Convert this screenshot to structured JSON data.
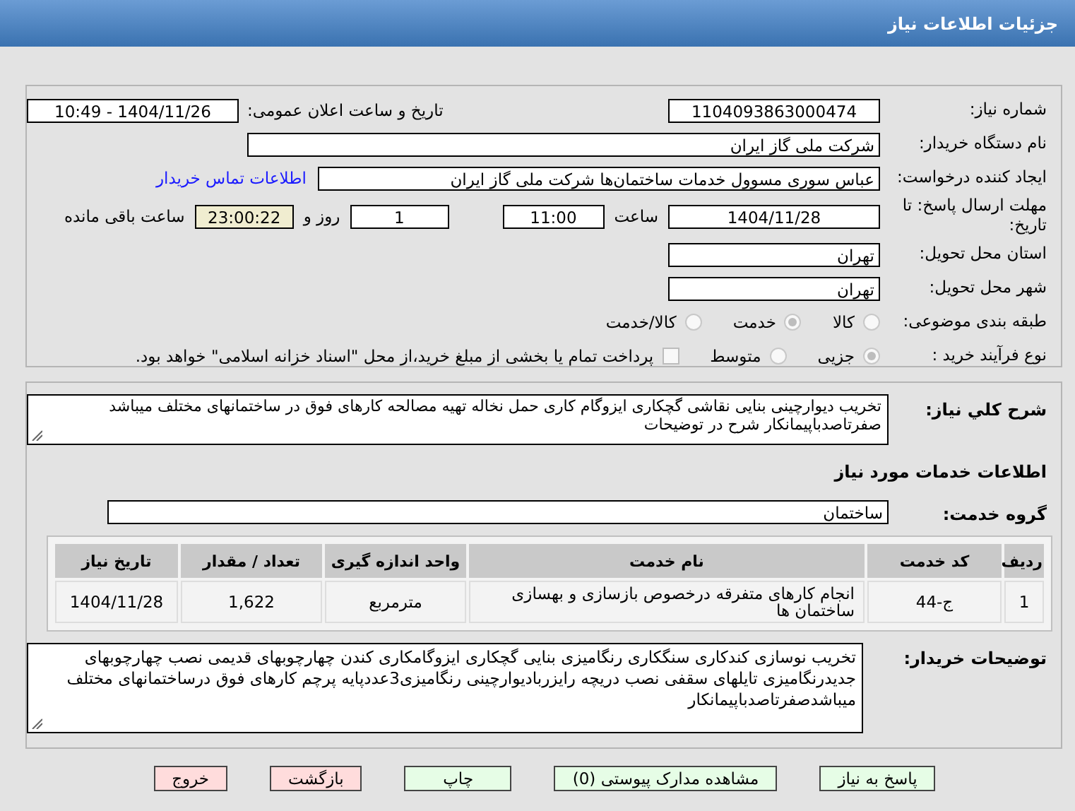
{
  "header": {
    "title": "جزئیات اطلاعات نیاز"
  },
  "details": {
    "need_number": {
      "label": "شماره نیاز:",
      "value": "1104093863000474"
    },
    "announce": {
      "label": "تاریخ و ساعت اعلان عمومی:",
      "value": "1404/11/26 - 10:49"
    },
    "buyer": {
      "label": "نام دستگاه خریدار:",
      "value": "شرکت ملی گاز ایران"
    },
    "creator": {
      "label": "ایجاد کننده درخواست:",
      "value": "عباس سوری مسوول خدمات ساختمان‌ها  شرکت ملی گاز ایران",
      "contact_link": "اطلاعات تماس خریدار"
    },
    "deadline": {
      "label": "مهلت ارسال پاسخ: تا تاریخ:",
      "date": "1404/11/28",
      "time_label": "ساعت",
      "time": "11:00",
      "days": "1",
      "days_label": "روز و",
      "remaining": "23:00:22",
      "remaining_label": "ساعت باقی مانده"
    },
    "province": {
      "label": "استان محل تحویل:",
      "value": "تهران"
    },
    "city": {
      "label": "شهر محل تحویل:",
      "value": "تهران"
    },
    "category": {
      "label": "طبقه بندی موضوعی:",
      "options": [
        {
          "label": "کالا",
          "selected": false
        },
        {
          "label": "خدمت",
          "selected": true
        },
        {
          "label": "کالا/خدمت",
          "selected": false
        }
      ]
    },
    "process": {
      "label": "نوع فرآیند خرید :",
      "options": [
        {
          "label": "جزیی",
          "selected": true
        },
        {
          "label": "متوسط",
          "selected": false
        }
      ],
      "treasury": {
        "label": "پرداخت تمام یا بخشی از مبلغ خرید،از محل \"اسناد خزانه اسلامی\" خواهد بود.",
        "checked": false
      }
    }
  },
  "need": {
    "label": "شرح کلي نياز:",
    "value": "تخریب دیوارچینی بنایی نقاشی گچکاری ایزوگام کاری حمل نخاله تهیه مصالحه کارهای فوق در ساختمانهای مختلف میباشد صفرتاصدباپیمانکار شرح در توضیحات"
  },
  "services": {
    "title": "اطلاعات خدمات مورد نیاز",
    "group": {
      "label": "گروه خدمت:",
      "value": "ساختمان"
    },
    "table": {
      "columns": [
        "ردیف",
        "کد خدمت",
        "نام خدمت",
        "واحد اندازه گیری",
        "تعداد / مقدار",
        "تاریخ نیاز"
      ],
      "rows": [
        {
          "cells": [
            "1",
            "ج-44",
            "انجام کارهای متفرقه درخصوص بازسازی و بهسازی ساختمان ها",
            "مترمربع",
            "1,622",
            "1404/11/28"
          ]
        }
      ]
    }
  },
  "buyer_notes": {
    "label": "توضیحات خریدار:",
    "value": "تخریب نوسازی کندکاری سنگکاری رنگامیزی بنایی گچکاری ایزوگامکاری کندن چهارچوبهای قدیمی نصب چهارچوبهای جدیدرنگامیزی تایلهای سقفی نصب دریچه رایزربادیوارچینی رنگامیزی3عددپایه پرچم کارهای فوق درساختمانهای مختلف میباشدصفرتاصدباپیمانکار"
  },
  "buttons": [
    {
      "label": "پاسخ به نیاز",
      "kind": "action"
    },
    {
      "label": "مشاهده مدارک پیوستی (0)",
      "kind": "action"
    },
    {
      "label": "چاپ",
      "kind": "action"
    },
    {
      "label": "بازگشت",
      "kind": "exit"
    },
    {
      "label": "خروج",
      "kind": "exit"
    }
  ]
}
